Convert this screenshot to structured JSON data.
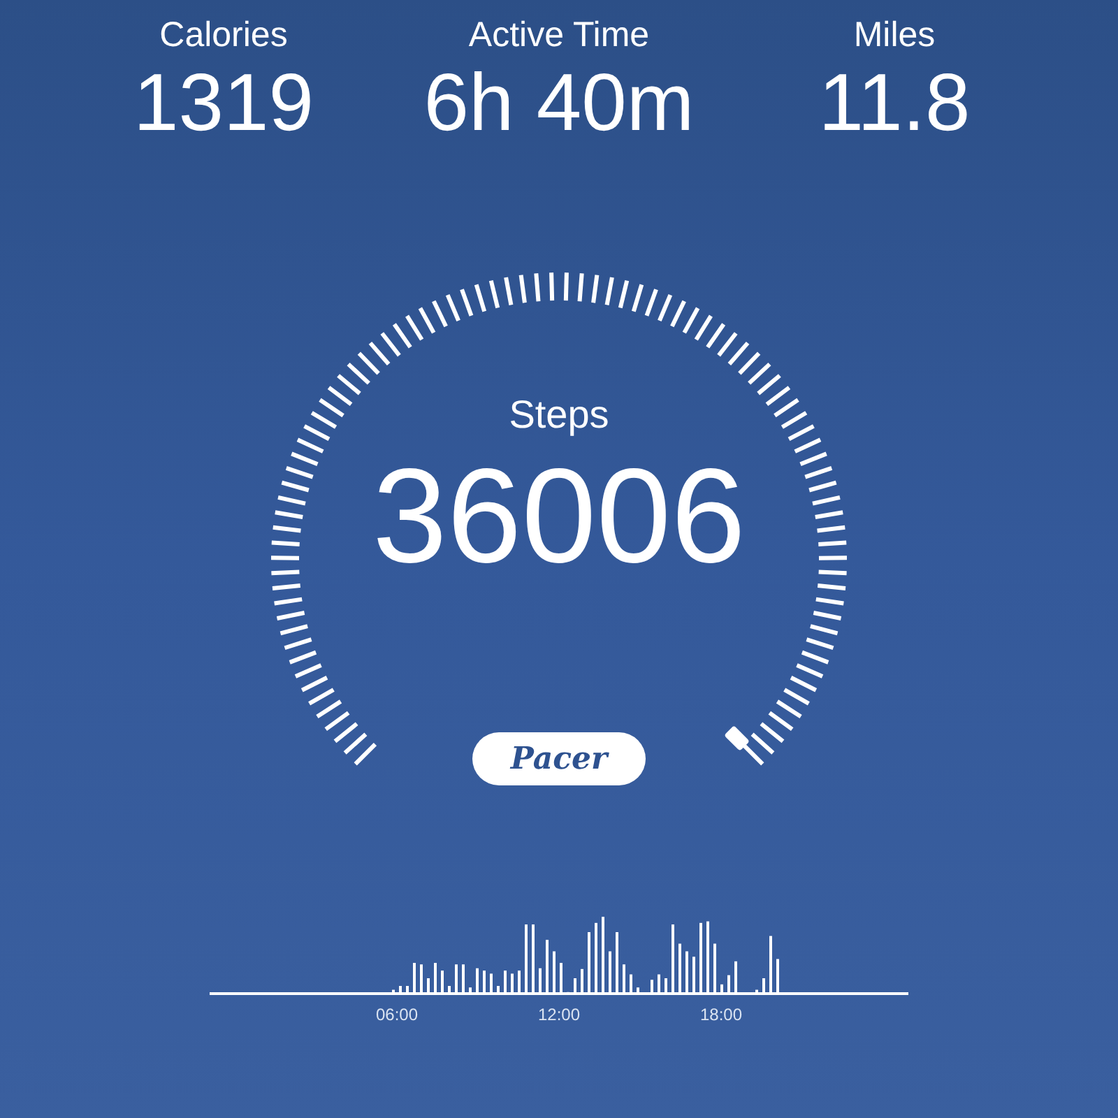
{
  "stats": [
    {
      "label": "Calories",
      "value": "1319"
    },
    {
      "label": "Active Time",
      "value": "6h 40m"
    },
    {
      "label": "Miles",
      "value": "11.8"
    }
  ],
  "steps": {
    "label": "Steps",
    "value": "36006"
  },
  "logo": "Pacer",
  "activity_chart": {
    "time_labels": [
      "06:00",
      "12:00",
      "18:00"
    ]
  }
}
